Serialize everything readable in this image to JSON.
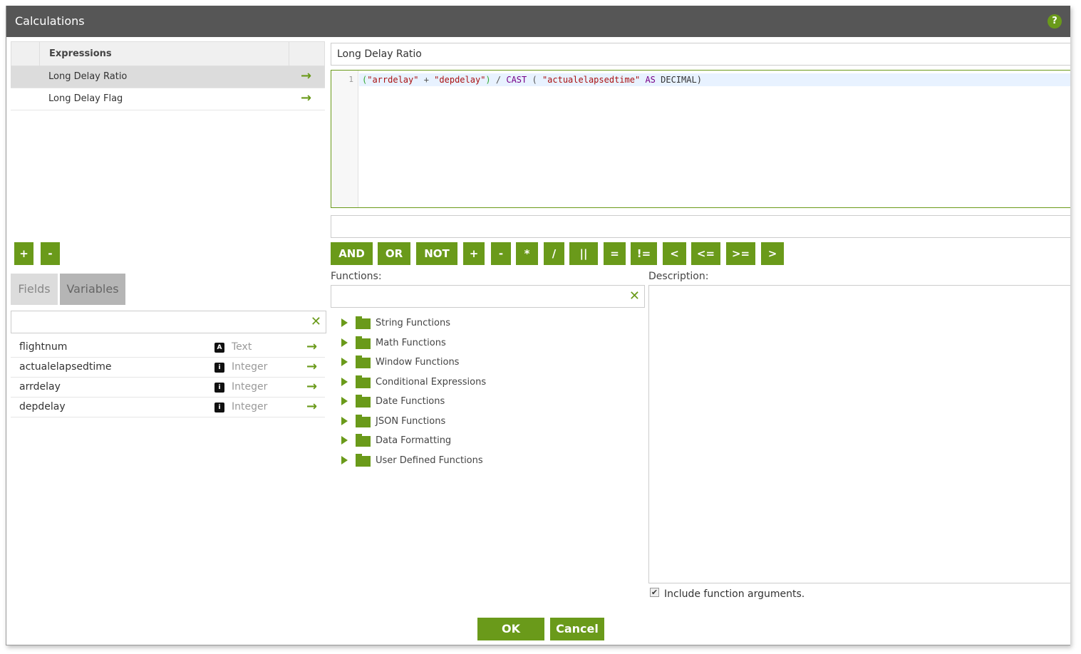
{
  "window": {
    "title": "Calculations",
    "help_icon": "question-circle-icon"
  },
  "expressions": {
    "header": "Expressions",
    "items": [
      {
        "label": "Long Delay Ratio",
        "selected": true
      },
      {
        "label": "Long Delay Flag",
        "selected": false
      }
    ],
    "add_label": "+",
    "remove_label": "-"
  },
  "tabs": [
    {
      "label": "Fields"
    },
    {
      "label": "Variables"
    }
  ],
  "field_search": {
    "value": "",
    "placeholder": ""
  },
  "fields": [
    {
      "name": "flightnum",
      "type_icon": "A",
      "type": "Text"
    },
    {
      "name": "actualelapsedtime",
      "type_icon": "i",
      "type": "Integer"
    },
    {
      "name": "arrdelay",
      "type_icon": "i",
      "type": "Integer"
    },
    {
      "name": "depdelay",
      "type_icon": "i",
      "type": "Integer"
    }
  ],
  "editor": {
    "name": "Long Delay Ratio",
    "line_number": "1",
    "tokens": {
      "p1": "(",
      "s1": "\"arrdelay\"",
      "plus": " + ",
      "s2": "\"depdelay\"",
      "p2": ")",
      "div": " / ",
      "cast": "CAST",
      "p3": " ( ",
      "s3": "\"actualelapsedtime\"",
      "as": " AS ",
      "dec": "DECIMAL",
      "p4": ")"
    }
  },
  "operators": [
    "AND",
    "OR",
    "NOT",
    "+",
    "-",
    "*",
    "/",
    "||",
    "=",
    "!=",
    "<",
    "<=",
    ">=",
    ">"
  ],
  "functions": {
    "label": "Functions:",
    "search_value": "",
    "categories": [
      "String Functions",
      "Math Functions",
      "Window Functions",
      "Conditional Expressions",
      "Date Functions",
      "JSON Functions",
      "Data Formatting",
      "User Defined Functions"
    ]
  },
  "description": {
    "label": "Description:",
    "include_args_label": "Include function arguments.",
    "include_args_checked": true
  },
  "footer": {
    "ok_label": "OK",
    "cancel_label": "Cancel"
  },
  "colors": {
    "accent": "#6a9a1a",
    "titlebar": "#565656"
  }
}
